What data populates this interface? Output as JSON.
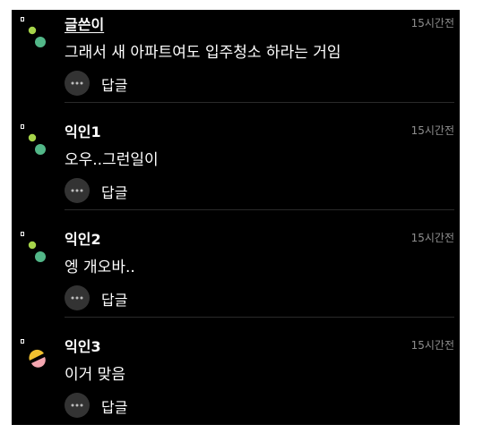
{
  "comments": [
    {
      "author": "글쓴이",
      "is_op": true,
      "time": "15시간전",
      "text": "그래서 새 아파트여도 입주청소 하라는 거임",
      "reply_label": "답글",
      "more_icon": "more-dots-icon",
      "avatar": "green-dots-avatar"
    },
    {
      "author": "익인1",
      "is_op": false,
      "time": "15시간전",
      "text": "오우..그런일이",
      "reply_label": "답글",
      "more_icon": "more-dots-icon",
      "avatar": "green-dots-avatar"
    },
    {
      "author": "익인2",
      "is_op": false,
      "time": "15시간전",
      "text": "엥 개오바..",
      "reply_label": "답글",
      "more_icon": "more-dots-icon",
      "avatar": "green-dots-avatar"
    },
    {
      "author": "익인3",
      "is_op": false,
      "time": "15시간전",
      "text": "이거 맞음",
      "reply_label": "답글",
      "more_icon": "more-dots-icon",
      "avatar": "yellow-pink-avatar"
    }
  ],
  "colors": {
    "background": "#000000",
    "text": "#ffffff",
    "muted": "#8e8e8e",
    "avatar_green": "#52b788",
    "avatar_lime": "#a6d44a",
    "avatar_yellow": "#f2c230",
    "avatar_pink": "#f4a6b0"
  }
}
